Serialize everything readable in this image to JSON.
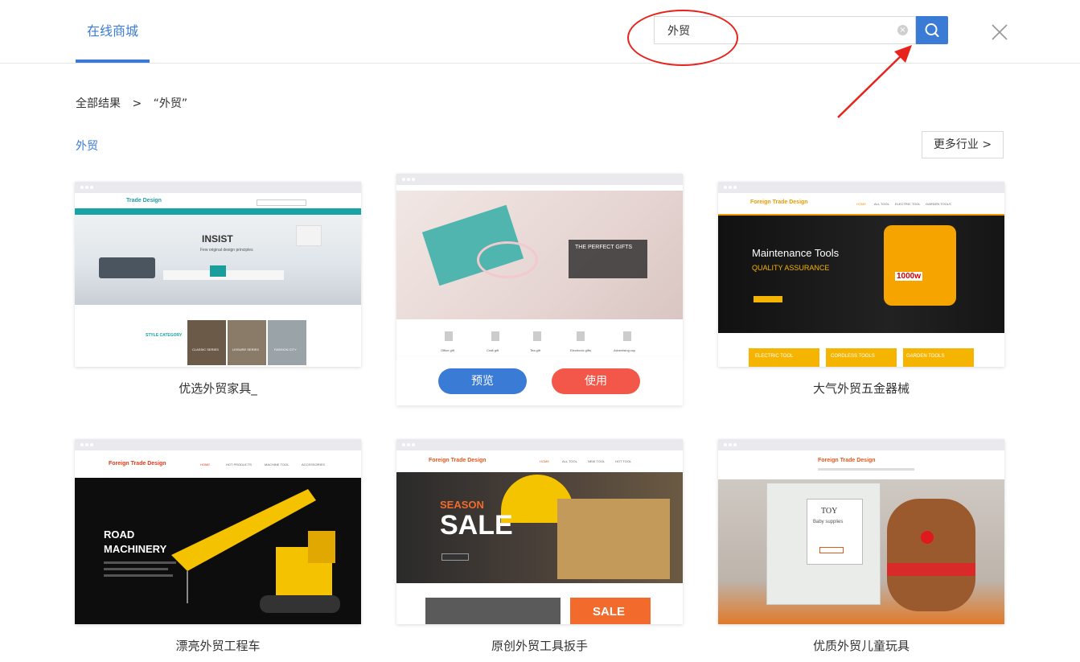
{
  "header": {
    "tab_label": "在线商城"
  },
  "search": {
    "value": "外贸",
    "clear_icon": "clear-icon",
    "button_icon": "search-icon"
  },
  "close_icon": "close-icon",
  "breadcrumb": {
    "root": "全部结果",
    "separator": ">",
    "current": "“外贸”"
  },
  "section": {
    "title": "外贸",
    "more_button": "更多行业 >"
  },
  "annotation": {
    "color": "#e8231c"
  },
  "colors": {
    "accent": "#3a7bd5",
    "use_button": "#f2574a"
  },
  "cards": [
    {
      "title": "优选外贸家具_",
      "brand": "Trade Design",
      "hero": "INSIST",
      "hero_sub": "Few original design principles",
      "category": "STYLE CATEGORY",
      "tiles": [
        "CLASSIC SERIES",
        "LEISURE SERIES",
        "FASHION CITY"
      ]
    },
    {
      "title": "",
      "hero": "THE PERFECT GIFTS",
      "icons": [
        "Office gift",
        "Craft gift",
        "Tea gift",
        "Electronic gifts",
        "Advertising cup"
      ],
      "preview_label": "预览",
      "use_label": "使用"
    },
    {
      "title": "大气外贸五金器械",
      "brand": "Foreign Trade Design",
      "nav": [
        "HOME",
        "ALL TOOL",
        "ELECTRIC TOOL",
        "GARDEN TOOLS"
      ],
      "hero": "Maintenance Tools",
      "hero_sub": "QUALITY ASSURANCE",
      "badge": "1000w",
      "tiles": [
        "ELECTRIC TOOL",
        "CORDLESS TOOLS",
        "GARDEN TOOLS"
      ]
    },
    {
      "title": "漂亮外贸工程车",
      "brand": "Foreign Trade Design",
      "nav": [
        "HOME",
        "HOT PRODUCTS",
        "MACHINE TOOL",
        "ACCESSORIES"
      ],
      "hero": "ROAD MACHINERY"
    },
    {
      "title": "原创外贸工具扳手",
      "brand": "Foreign Trade Design",
      "nav": [
        "HOME",
        "ALL TOOL",
        "NEW TOOL",
        "HOT TOOL"
      ],
      "hero_top": "SEASON",
      "hero": "SALE",
      "banner": "SALE"
    },
    {
      "title": "优质外贸儿童玩具",
      "brand": "Foreign Trade Design",
      "hero": "TOY",
      "hero_sub": "Baby supplies"
    }
  ]
}
